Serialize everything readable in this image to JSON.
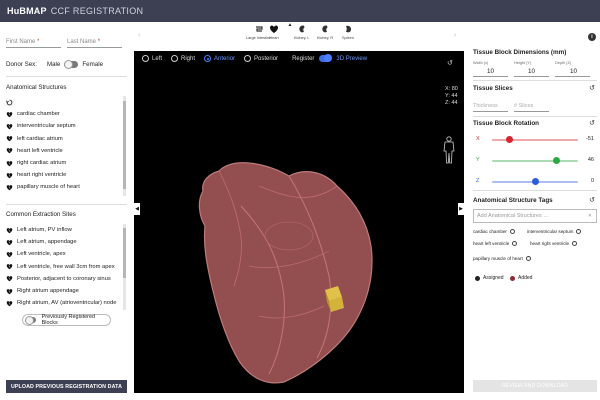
{
  "header": {
    "brand": "HuBMAP",
    "title": "CCF REGISTRATION"
  },
  "left": {
    "first_name_label": "First Name",
    "last_name_label": "Last Name",
    "required_mark": "*",
    "donor_sex_label": "Donor Sex:",
    "sex_male": "Male",
    "sex_female": "Female",
    "anatomical_title": "Anatomical Structures",
    "structures": [
      "cardiac chamber",
      "interventricular septum",
      "left cardiac atrium",
      "heart left ventricle",
      "right cardiac atrium",
      "heart right ventricle",
      "papillary muscle of heart"
    ],
    "extraction_title": "Common Extraction Sites",
    "sites": [
      "Left atrium, PV inflow",
      "Left atrium, appendage",
      "Left ventricle, apex",
      "Left ventricle, free wall 3cm from apex",
      "Posterior, adjacent to coronary sinus",
      "Right atrium appendage",
      "Right atrium, AV (atrioventricular) node"
    ],
    "prev_blocks_label": "Previously Registered Blocks",
    "upload_label": "UPLOAD PREVIOUS REGISTRATION DATA"
  },
  "carousel": {
    "organs": [
      {
        "name": "Large Intestine",
        "icon": "intestine-icon"
      },
      {
        "name": "Heart",
        "icon": "heart-icon"
      },
      {
        "name": "Kidney, L",
        "icon": "kidney-icon"
      },
      {
        "name": "Kidney, R",
        "icon": "kidney-icon"
      },
      {
        "name": "Spleen",
        "icon": "spleen-icon"
      }
    ]
  },
  "viewer": {
    "views": [
      "Left",
      "Right",
      "Anterior",
      "Posterior"
    ],
    "selected_view": "Anterior",
    "register_label": "Register",
    "preview_label": "3D Preview",
    "coords": {
      "x": "X: 80",
      "y": "Y: 44",
      "z": "Z: 44"
    },
    "colors": {
      "heart": "#a85a5a",
      "block": "#d4b33a"
    }
  },
  "right": {
    "dims_title": "Tissue Block Dimensions (mm)",
    "width_label": "Width (x)",
    "width_val": "10",
    "height_label": "Height (Y)",
    "height_val": "10",
    "depth_label": "Depth (Z)",
    "depth_val": "10",
    "slices_title": "Tissue Slices",
    "thickness_ph": "Thickness",
    "slices_ph": "# Slices",
    "rotation_title": "Tissue Block Rotation",
    "rotation": [
      {
        "axis": "X",
        "value": "-51",
        "fraction": 0.2,
        "color": "#d9262b"
      },
      {
        "axis": "Y",
        "value": "46",
        "fraction": 0.75,
        "color": "#2ca842"
      },
      {
        "axis": "Z",
        "value": "0",
        "fraction": 0.5,
        "color": "#2f5cdb"
      }
    ],
    "tags_title": "Anatomical Structure Tags",
    "tags_placeholder": "Add Anatomical Structures ...",
    "tags": [
      "cardiac chamber",
      "interventricular septum",
      "heart left ventricle",
      "heart right ventricle",
      "papillary muscle of heart"
    ],
    "assigned_label": "Assigned",
    "added_label": "Added",
    "review_label": "REVIEW AND DOWNLOAD"
  }
}
